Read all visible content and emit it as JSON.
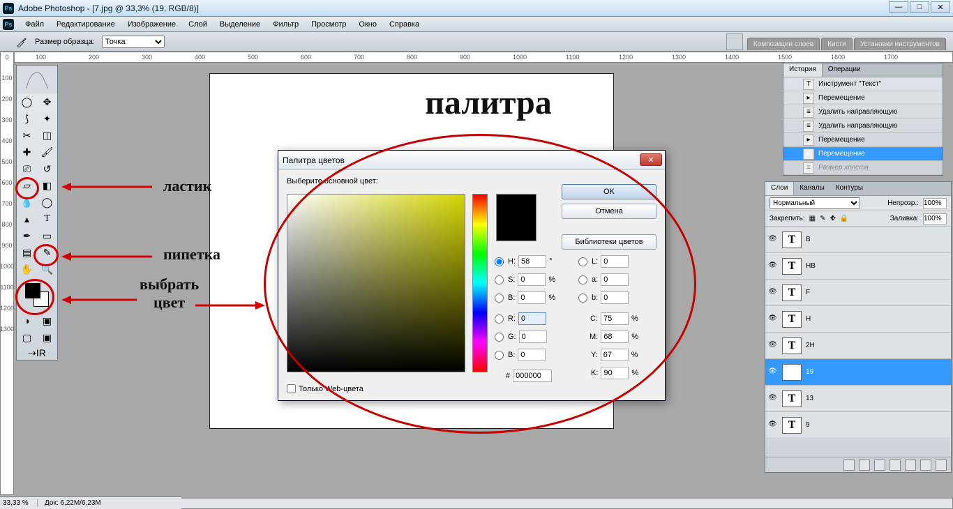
{
  "titlebar": {
    "app": "Adobe Photoshop",
    "doc": "[7.jpg @ 33,3% (19, RGB/8)]"
  },
  "menubar": [
    "Файл",
    "Редактирование",
    "Изображение",
    "Слой",
    "Выделение",
    "Фильтр",
    "Просмотр",
    "Окно",
    "Справка"
  ],
  "optionsbar": {
    "label": "Размер образца:",
    "value": "Точка"
  },
  "palette_tabs": [
    "Композиции слоев",
    "Кисти",
    "Установки инструментов"
  ],
  "ruler_marks": [
    "100",
    "200",
    "300",
    "400",
    "500",
    "600",
    "700",
    "800",
    "900",
    "1000",
    "1100",
    "1200",
    "1300",
    "1400",
    "1500",
    "1600",
    "1700"
  ],
  "ruler_v": [
    "0",
    "100",
    "200",
    "300",
    "400",
    "500",
    "600",
    "700",
    "800",
    "900",
    "1000",
    "1100",
    "1200",
    "1300"
  ],
  "canvas": {
    "headline": "палитра"
  },
  "annot": {
    "eraser": "ластик",
    "eyedrop": "пипетка",
    "pick": "выбрать\nцвет"
  },
  "colorpicker": {
    "title": "Палитра цветов",
    "prompt": "Выберите основной цвет:",
    "ok": "OK",
    "cancel": "Отмена",
    "lib": "Библиотеки цветов",
    "H": "58",
    "S": "0",
    "Bv": "0",
    "R": "0",
    "G": "0",
    "B": "0",
    "L": "0",
    "a": "0",
    "b": "0",
    "C": "75",
    "M": "68",
    "Y": "67",
    "K": "90",
    "hex": "000000",
    "web": "Только Web-цвета",
    "deg": "°",
    "pct": "%"
  },
  "history": {
    "tabs": [
      "История",
      "Операции"
    ],
    "items": [
      {
        "icon": "T",
        "label": "Инструмент \"Текст\"",
        "sel": false
      },
      {
        "icon": "▸",
        "label": "Перемещение",
        "sel": false
      },
      {
        "icon": "≡",
        "label": "Удалить направляющую",
        "sel": false
      },
      {
        "icon": "≡",
        "label": "Удалить направляющую",
        "sel": false
      },
      {
        "icon": "▸",
        "label": "Перемещение",
        "sel": false
      },
      {
        "icon": "▸",
        "label": "Перемещение",
        "sel": true
      },
      {
        "icon": "≡",
        "label": "Размер холста",
        "sel": false,
        "dim": true
      }
    ]
  },
  "layers": {
    "tabs": [
      "Слои",
      "Каналы",
      "Контуры"
    ],
    "blend": "Нормальный",
    "opacity_label": "Непрозр.:",
    "opacity": "100%",
    "lock_label": "Закрепить:",
    "fill_label": "Заливка:",
    "fill": "100%",
    "items": [
      {
        "name": "B"
      },
      {
        "name": "HB"
      },
      {
        "name": "F"
      },
      {
        "name": "H"
      },
      {
        "name": "2H"
      },
      {
        "name": "19",
        "sel": true
      },
      {
        "name": "13"
      },
      {
        "name": "9"
      }
    ]
  },
  "status": {
    "zoom": "33,33 %",
    "docsize": "Док: 6,22M/6,23M"
  }
}
